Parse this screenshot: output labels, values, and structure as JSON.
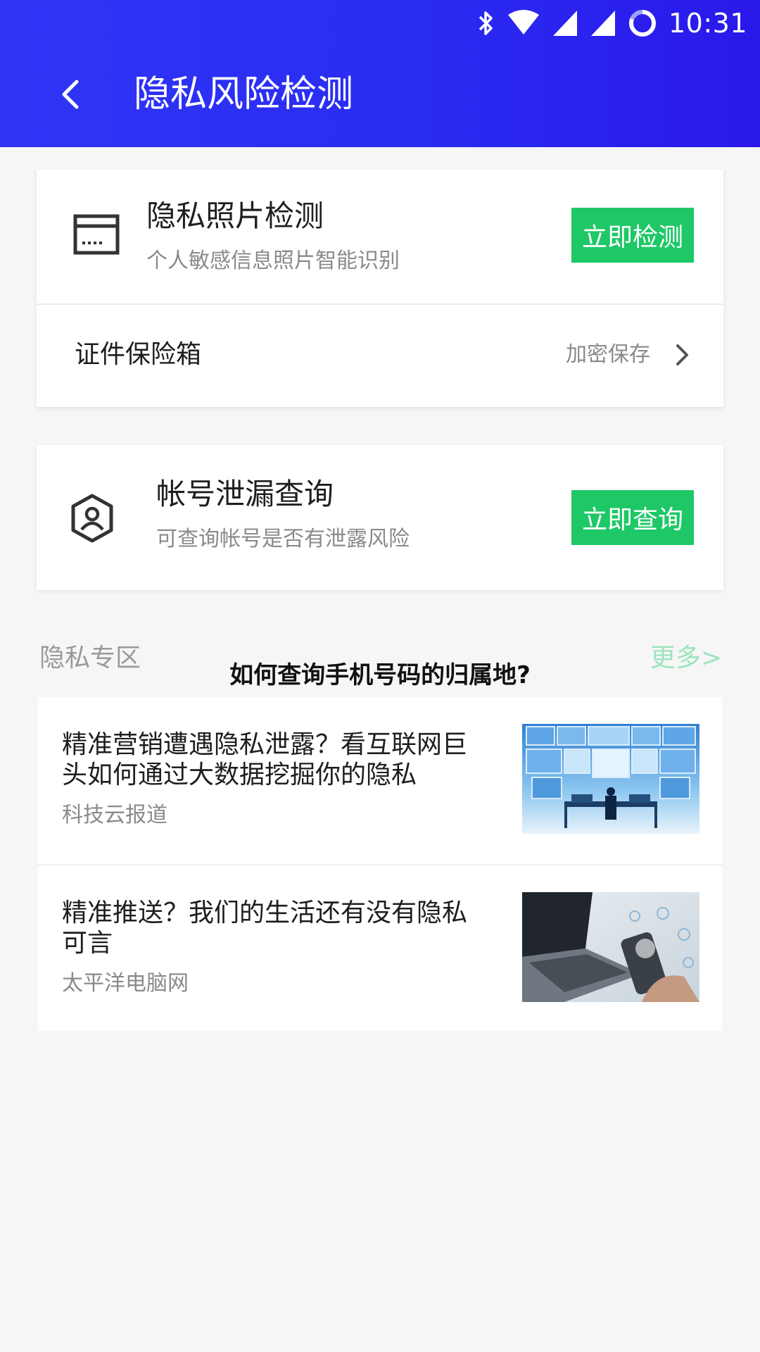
{
  "status_bar": {
    "time": "10:31"
  },
  "header": {
    "title": "隐私风险检测"
  },
  "photo_check": {
    "title": "隐私照片检测",
    "subtitle": "个人敏感信息照片智能识别",
    "button": "立即检测"
  },
  "vault": {
    "label": "证件保险箱",
    "hint": "加密保存"
  },
  "account_leak": {
    "title": "帐号泄漏查询",
    "subtitle": "可查询帐号是否有泄露风险",
    "button": "立即查询"
  },
  "privacy_zone": {
    "title": "隐私专区",
    "more": "更多>",
    "overlay_title": "如何查询手机号码的归属地?"
  },
  "news": [
    {
      "title": "精准营销遭遇隐私泄露？看互联网巨头如何通过大数据挖掘你的隐私",
      "source": "科技云报道",
      "thumb_icon": "server-room-thumbnail"
    },
    {
      "title": "精准推送？我们的生活还有没有隐私可言",
      "source": "太平洋电脑网",
      "thumb_icon": "laptop-phone-thumbnail"
    }
  ],
  "colors": {
    "header_gradient_start": "#2f35f5",
    "header_gradient_end": "#2a18ea",
    "action_green": "#1ec866",
    "more_link": "#9ee3be"
  }
}
